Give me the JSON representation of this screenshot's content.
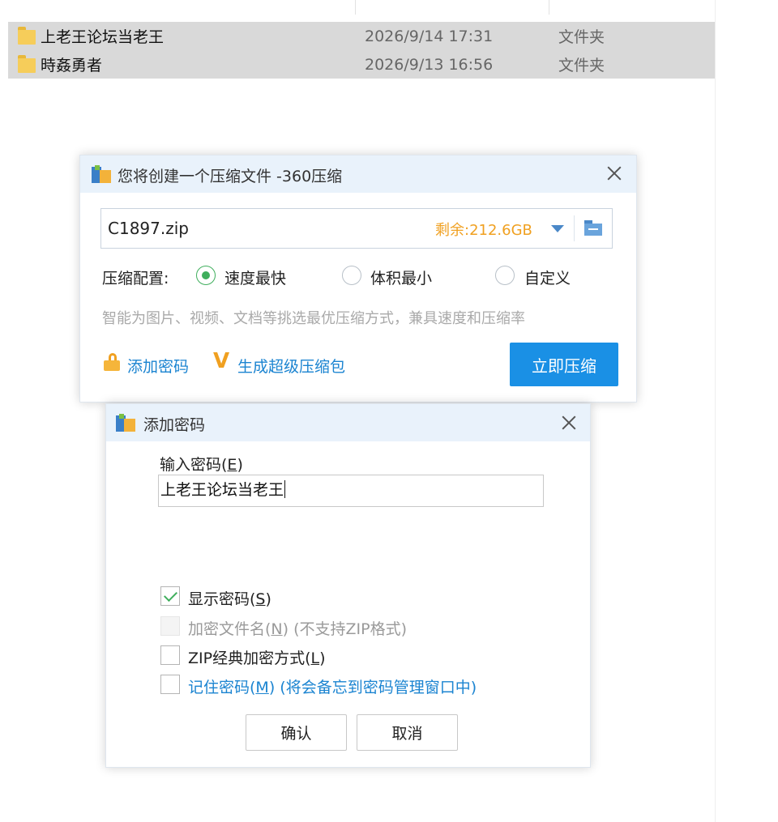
{
  "explorer": {
    "rows": [
      {
        "name": "上老王论坛当老王",
        "date": "2026/9/14 17:31",
        "type": "文件夹"
      },
      {
        "name": "時姦勇者",
        "date": "2026/9/13 16:56",
        "type": "文件夹"
      }
    ]
  },
  "compress_dialog": {
    "title": "您将创建一个压缩文件 -360压缩",
    "file_name": "C1897.zip",
    "free_space": "剩余:212.6GB",
    "config_label": "压缩配置:",
    "options": [
      {
        "label": "速度最快",
        "selected": true
      },
      {
        "label": "体积最小",
        "selected": false
      },
      {
        "label": "自定义",
        "selected": false
      }
    ],
    "hint": "智能为图片、视频、文档等挑选最优压缩方式，兼具速度和压缩率",
    "add_password_link": "添加密码",
    "super_pack_link": "生成超级压缩包",
    "compress_button": "立即压缩"
  },
  "password_dialog": {
    "title": "添加密码",
    "input_label_prefix": "输入密码(",
    "input_label_key": "E",
    "input_label_suffix": ")",
    "password_value": "上老王论坛当老王",
    "checkboxes": [
      {
        "prefix": "显示密码(",
        "key": "S",
        "suffix": ")",
        "checked": true,
        "disabled": false
      },
      {
        "prefix": "加密文件名(",
        "key": "N",
        "suffix": ") (不支持ZIP格式)",
        "checked": false,
        "disabled": true
      },
      {
        "prefix": "ZIP经典加密方式(",
        "key": "L",
        "suffix": ")",
        "checked": false,
        "disabled": false
      },
      {
        "prefix": "记住密码(",
        "key": "M",
        "suffix": ") (将会备忘到密码管理窗口中)",
        "checked": false,
        "disabled": false
      }
    ],
    "ok_button": "确认",
    "cancel_button": "取消"
  },
  "colors": {
    "accent": "#1a90e5",
    "warning": "#f0a020",
    "selection": "#d9d9d9",
    "check_green": "#3fae5c",
    "link_blue": "#1b84d1"
  }
}
